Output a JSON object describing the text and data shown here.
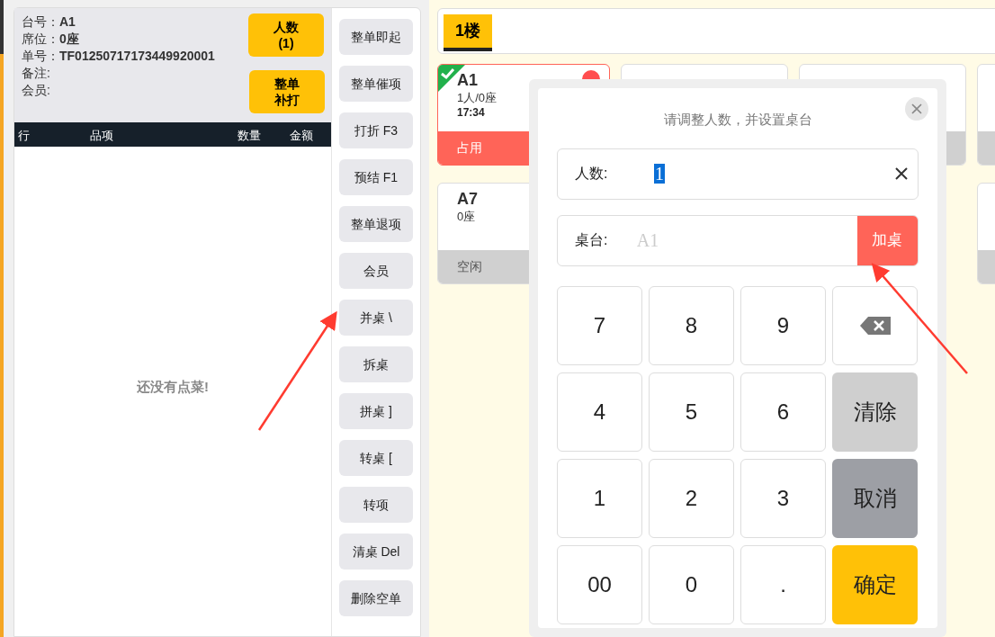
{
  "order": {
    "fields": [
      {
        "label": "台号：",
        "value": "A1"
      },
      {
        "label": "席位：",
        "value": "0座"
      },
      {
        "label": "单号：",
        "value": "TF01250717173449920001"
      },
      {
        "label": "备注:"
      },
      {
        "label": "会员:"
      }
    ],
    "guests_button": [
      "人数",
      "(1)"
    ],
    "reprint_button": [
      "整单",
      "补打"
    ],
    "columns": [
      "行",
      "品项",
      "数量",
      "金额"
    ],
    "empty_text": "还没有点菜!"
  },
  "actions": [
    "整单即起",
    "整单催项",
    "打折 F3",
    "预结 F1",
    "整单退项",
    "会员",
    "并桌 \\",
    "拆桌",
    "拼桌 ]",
    "转桌 [",
    "转项",
    "清桌 Del",
    "删除空单"
  ],
  "floors": [
    {
      "label": "1楼",
      "selected": true
    }
  ],
  "table_rows": [
    [
      {
        "name": "A1",
        "info": "1人/0座",
        "time": "17:34",
        "status_label": "占用",
        "occupied": true,
        "checked": true,
        "alert": true
      },
      {
        "occupied": false,
        "checked": false,
        "alert": false
      },
      {
        "occupied": false,
        "checked": false,
        "alert": false,
        "status_bar": true
      },
      {
        "occupied": false,
        "checked": false,
        "alert": false,
        "status_bar": true
      }
    ],
    [
      {
        "name": "A7",
        "info": "0座",
        "status_label": "空闲",
        "occupied": false,
        "checked": false,
        "alert": false
      },
      {
        "occupied": false,
        "checked": false,
        "alert": false,
        "status_bar": true
      }
    ]
  ],
  "dialog": {
    "title": "请调整人数，并设置桌台",
    "guests_label": "人数:",
    "guests_value": "1",
    "guests_value_selected": true,
    "table_label": "桌台:",
    "table_placeholder": "A1",
    "add_table_button": "加桌",
    "keys": [
      {
        "label": "7",
        "kind": "digit"
      },
      {
        "label": "8",
        "kind": "digit"
      },
      {
        "label": "9",
        "kind": "digit"
      },
      {
        "kind": "backspace"
      },
      {
        "label": "4",
        "kind": "digit"
      },
      {
        "label": "5",
        "kind": "digit"
      },
      {
        "label": "6",
        "kind": "digit"
      },
      {
        "label": "清除",
        "kind": "clear"
      },
      {
        "label": "1",
        "kind": "digit"
      },
      {
        "label": "2",
        "kind": "digit"
      },
      {
        "label": "3",
        "kind": "digit"
      },
      {
        "label": "取消",
        "kind": "cancel"
      },
      {
        "label": "00",
        "kind": "digit"
      },
      {
        "label": "0",
        "kind": "digit"
      },
      {
        "label": ".",
        "kind": "digit"
      },
      {
        "label": "确定",
        "kind": "confirm"
      }
    ]
  }
}
